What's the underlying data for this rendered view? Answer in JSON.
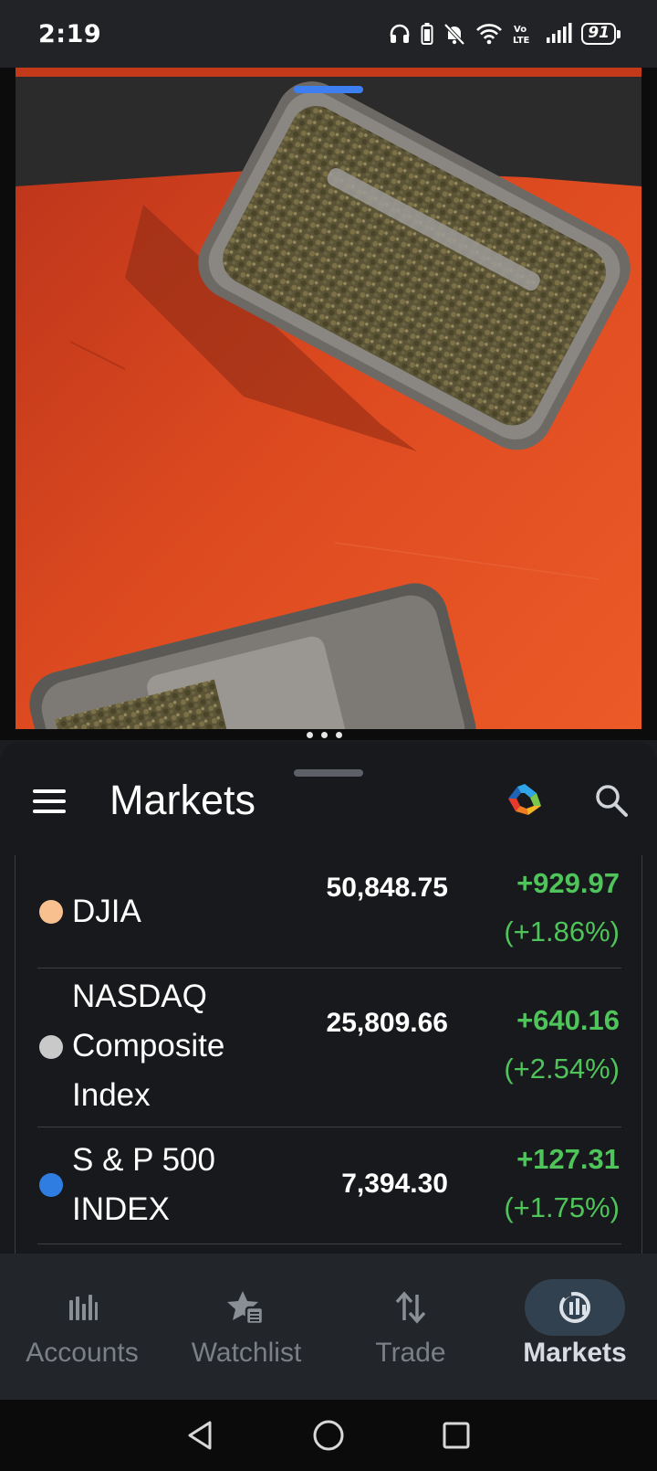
{
  "status_bar": {
    "time": "2:19",
    "battery": "91",
    "network": "Vo LTE"
  },
  "photo": {
    "description_icon": "photo-image"
  },
  "header": {
    "title": "Markets"
  },
  "markets": [
    {
      "name": "DJIA",
      "price": "50,848.75",
      "change": "+929.97",
      "percent": "(+1.86%)",
      "dot_color": "#f9c08f"
    },
    {
      "name": "NASDAQ Composite Index",
      "price": "25,809.66",
      "change": "+640.16",
      "percent": "(+2.54%)",
      "dot_color": "#c9c9c9"
    },
    {
      "name": "S & P 500 INDEX",
      "price": "7,394.30",
      "change": "+127.31",
      "percent": "(+1.75%)",
      "dot_color": "#2f7de1"
    }
  ],
  "colors": {
    "positive": "#4fc45a",
    "background": "#17191c",
    "active_nav_pill": "#32414f"
  },
  "bottom_nav": [
    {
      "label": "Accounts",
      "icon": "bar-chart-icon",
      "active": false
    },
    {
      "label": "Watchlist",
      "icon": "star-list-icon",
      "active": false
    },
    {
      "label": "Trade",
      "icon": "up-down-arrows-icon",
      "active": false
    },
    {
      "label": "Markets",
      "icon": "globe-chart-icon",
      "active": true
    }
  ]
}
